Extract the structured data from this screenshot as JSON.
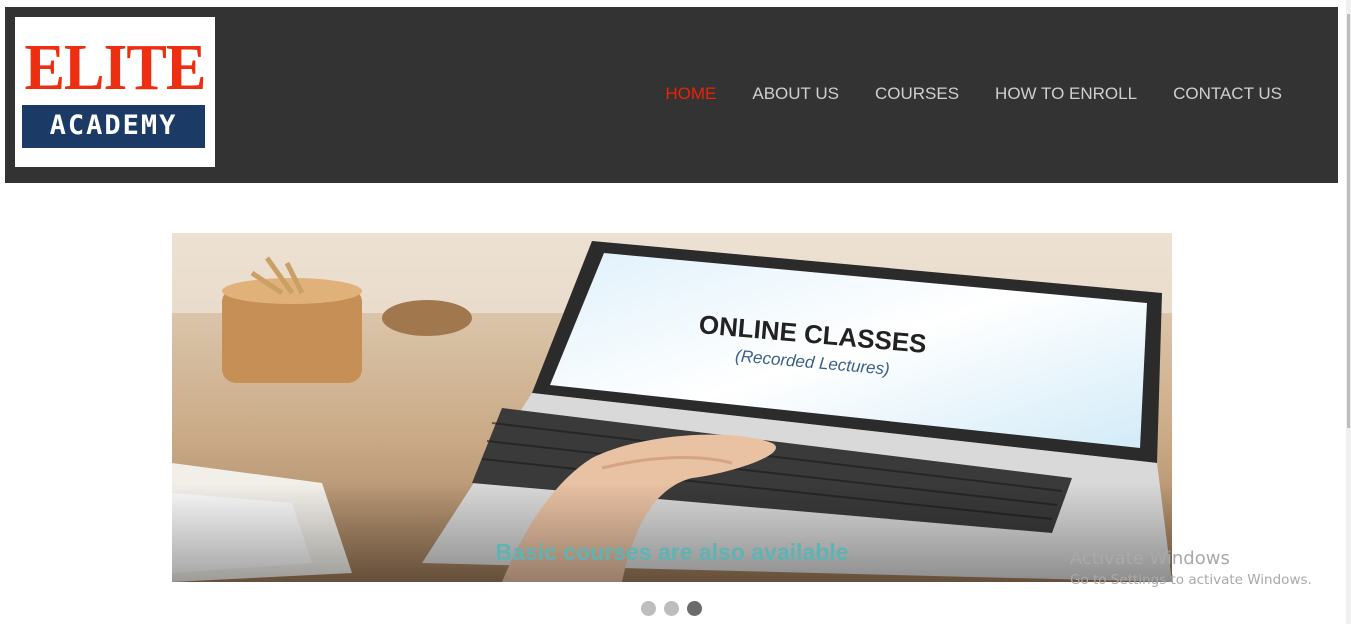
{
  "brand": {
    "elite": "ELITE",
    "academy": "ACADEMY"
  },
  "nav": {
    "items": [
      {
        "label": "HOME",
        "active": true
      },
      {
        "label": "ABOUT US",
        "active": false
      },
      {
        "label": "COURSES",
        "active": false
      },
      {
        "label": "HOW TO ENROLL",
        "active": false
      },
      {
        "label": "CONTACT US",
        "active": false
      }
    ]
  },
  "slider": {
    "screen_title": "ONLINE CLASSES",
    "screen_subtitle": "(Recorded Lectures)",
    "caption": "Basic courses are also available",
    "slide_count": 3,
    "active_slide": 3
  },
  "watermark": {
    "line1": "Activate Windows",
    "line2": "Go to Settings to activate Windows."
  },
  "colors": {
    "header_bg": "#333333",
    "nav_active": "#ee2200",
    "nav_text": "#cfcfcf",
    "logo_red": "#ee2e10",
    "logo_blue": "#1c3a66",
    "caption": "#5fb3b3"
  }
}
